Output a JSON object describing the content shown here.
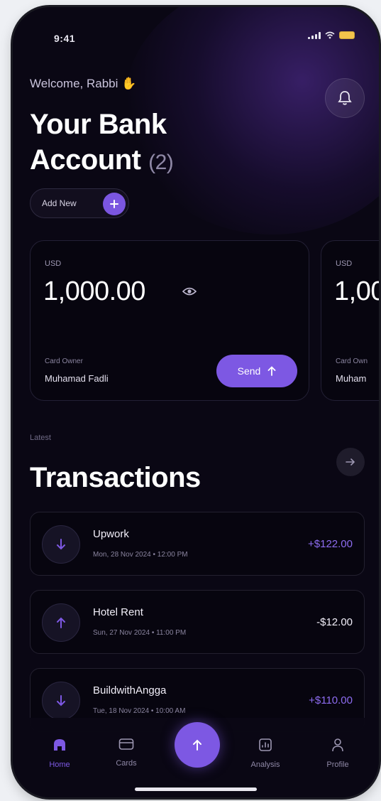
{
  "status": {
    "time": "9:41"
  },
  "header": {
    "welcome": "Welcome, Rabbi",
    "title_line1": "Your Bank",
    "title_line2": "Account",
    "count": "(2)",
    "add_new": "Add New"
  },
  "cards": [
    {
      "currency": "USD",
      "amount": "1,000.00",
      "holder_label": "Card Owner",
      "holder": "Muhamad Fadli",
      "send_label": "Send"
    },
    {
      "currency": "USD",
      "amount": "1,00",
      "holder_label": "Card Own",
      "holder": "Muham"
    }
  ],
  "transactions": {
    "eyebrow": "Latest",
    "title": "Transactions",
    "items": [
      {
        "name": "Upwork",
        "date": "Mon, 28 Nov 2024  •  12:00 PM",
        "amount": "+$122.00",
        "direction": "in"
      },
      {
        "name": "Hotel Rent",
        "date": "Sun, 27 Nov 2024  •  11:00 PM",
        "amount": "-$12.00",
        "direction": "out"
      },
      {
        "name": "BuildwithAngga",
        "date": "Tue, 18 Nov 2024  •  10:00 AM",
        "amount": "+$110.00",
        "direction": "in"
      }
    ]
  },
  "nav": {
    "home": "Home",
    "cards": "Cards",
    "analysis": "Analysis",
    "profile": "Profile"
  },
  "colors": {
    "accent": "#7d58e3",
    "background": "#0a0714",
    "income": "#8d6cf0"
  }
}
